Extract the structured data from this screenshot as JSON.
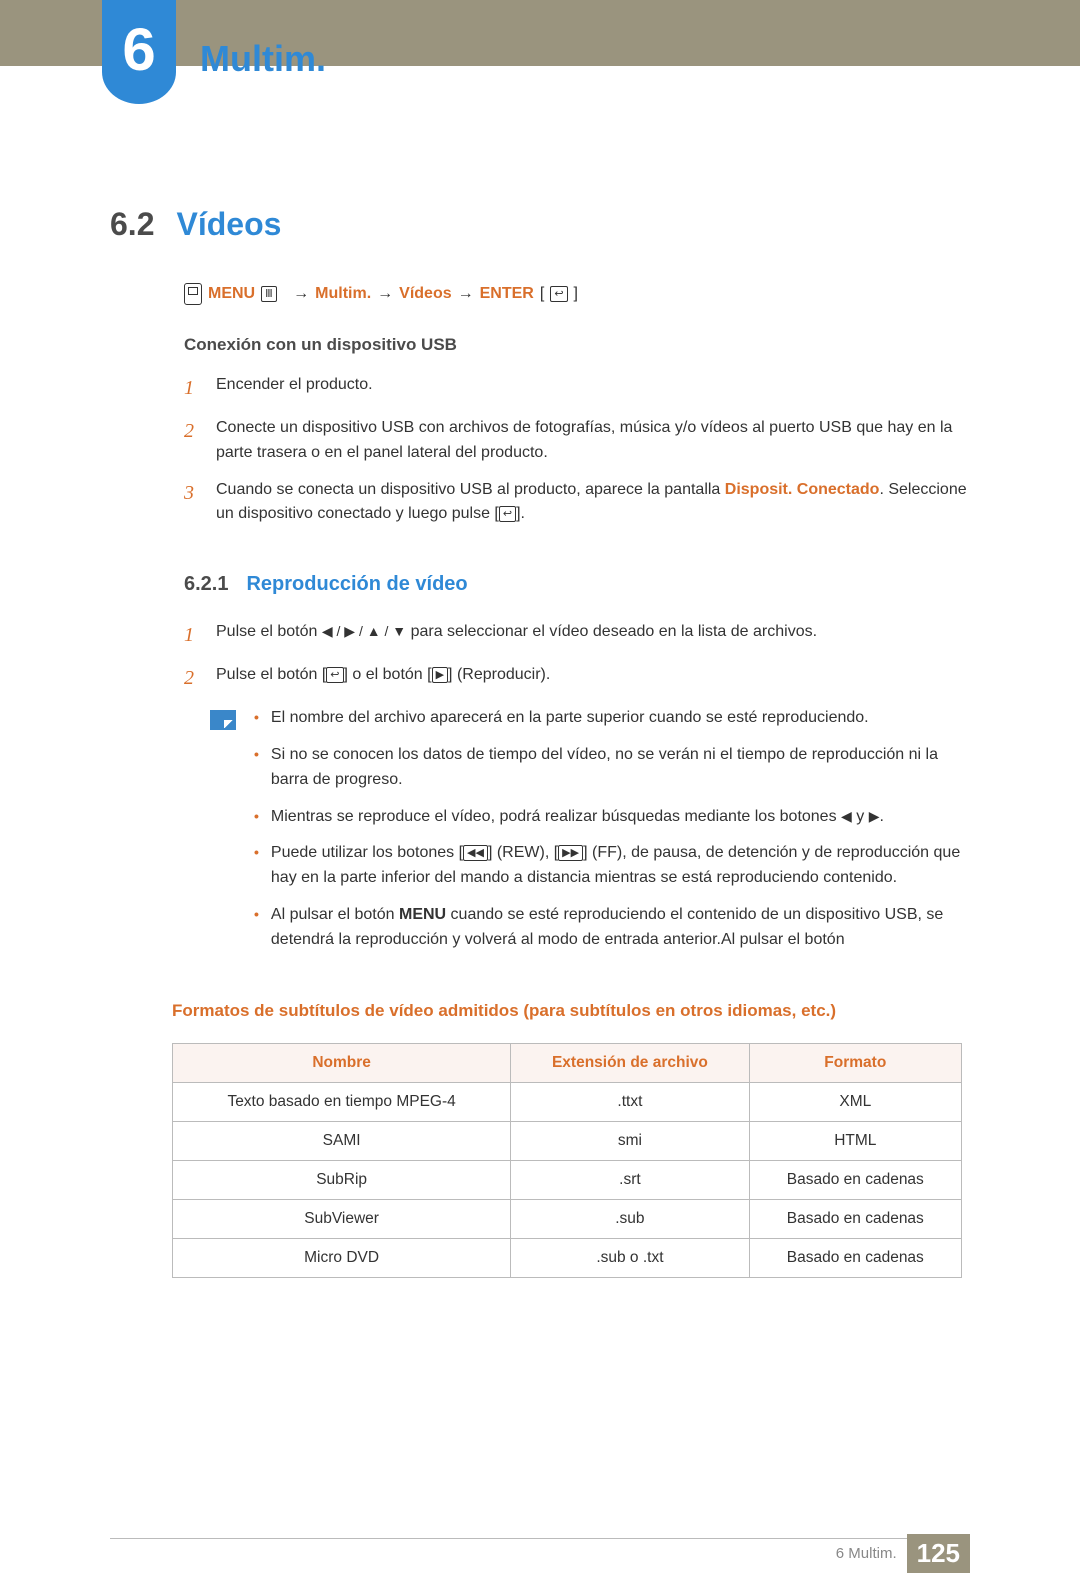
{
  "chapter": {
    "num": "6",
    "title": "Multim."
  },
  "section": {
    "num": "6.2",
    "title": "Vídeos"
  },
  "menupath": {
    "menu": "MENU",
    "arrow": "→",
    "p1": "Multim.",
    "p2": "Vídeos",
    "enter": "ENTER"
  },
  "sub1": {
    "heading": "Conexión con un dispositivo USB",
    "steps": [
      {
        "text": "Encender el producto."
      },
      {
        "text": "Conecte un dispositivo USB con archivos de fotografías, música y/o vídeos al puerto USB que hay en la parte trasera o en el panel lateral del producto."
      },
      {
        "pre": "Cuando se conecta un dispositivo USB al producto, aparece la pantalla ",
        "em": "Disposit. Conectado",
        "post": ". Seleccione un dispositivo conectado y luego pulse [",
        "post2": "]."
      }
    ]
  },
  "sub2": {
    "num": "6.2.1",
    "title": "Reproducción de vídeo",
    "steps": [
      {
        "a": "Pulse el botón ",
        "nav": "◀ / ▶ / ▲ / ▼",
        "b": " para seleccionar el vídeo deseado en la lista de archivos."
      },
      {
        "a": "Pulse el botón [",
        "b": "] o el botón [",
        "c": "] (Reproducir)."
      }
    ],
    "notes": [
      "El nombre del archivo aparecerá en la parte superior cuando se esté reproduciendo.",
      "Si no se conocen los datos de tiempo del vídeo, no se verán ni el tiempo de reproducción ni la barra de progreso.",
      {
        "a": "Mientras se reproduce el vídeo, podrá realizar búsquedas mediante los botones ",
        "b": " y ",
        "c": "."
      },
      {
        "a": "Puede utilizar los botones [",
        "b": "] (REW), [",
        "c": "] (FF), de pausa, de detención y de reproducción que hay en la parte inferior del mando a distancia mientras se está reproduciendo contenido."
      },
      {
        "a": "Al pulsar el botón ",
        "em": "MENU",
        "b": " cuando se esté reproduciendo el contenido de un dispositivo USB, se detendrá la reproducción y volverá al modo de entrada anterior.Al pulsar el botón"
      }
    ]
  },
  "table": {
    "caption": "Formatos de subtítulos de vídeo admitidos (para subtítulos en otros idiomas, etc.)",
    "headers": [
      "Nombre",
      "Extensión de archivo",
      "Formato"
    ],
    "rows": [
      [
        "Texto basado en tiempo MPEG-4",
        ".ttxt",
        "XML"
      ],
      [
        "SAMI",
        "smi",
        "HTML"
      ],
      [
        "SubRip",
        ".srt",
        "Basado en cadenas"
      ],
      [
        "SubViewer",
        ".sub",
        "Basado en cadenas"
      ],
      [
        "Micro DVD",
        ".sub o .txt",
        "Basado en cadenas"
      ]
    ]
  },
  "footer": {
    "chap": "6 Multim.",
    "page": "125"
  }
}
